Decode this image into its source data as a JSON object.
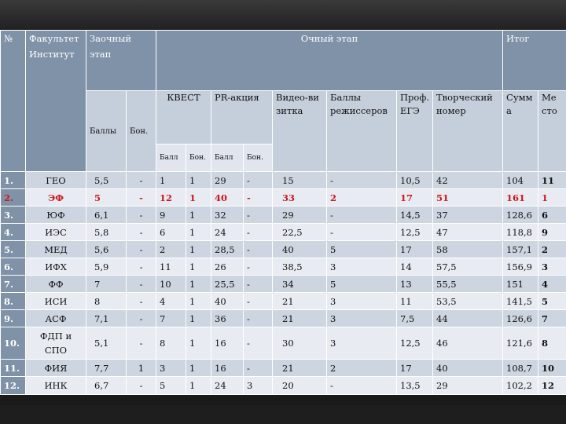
{
  "header": {
    "num": "№",
    "faculty": "Факультет Институт",
    "zaochny": "Заочный этап",
    "ochny": "Очный этап",
    "itog": "Итог",
    "balls": "Баллы",
    "bon": "Бон.",
    "kvest": "КВЕСТ",
    "pr": "PR-акция",
    "video": "Видео-ви зитка",
    "director": "Баллы режиссеров",
    "prof": "Проф. ЕГЭ",
    "tvorch": "Творческий номер",
    "summa": "Сумм а",
    "mesto": "Ме сто",
    "ball_sub": "Балл",
    "bon_sub": "Бон."
  },
  "rows": [
    {
      "n": "1.",
      "f": "ГЕО",
      "zb": "5,5",
      "zbon": "-",
      "kb": "1",
      "kbon": "1",
      "pb": "29",
      "pbon": "-",
      "v": "15",
      "d": "-",
      "p": "10,5",
      "t": "42",
      "s": "104",
      "m": "11",
      "highlight": false
    },
    {
      "n": "2.",
      "f": "ЭФ",
      "zb": "5",
      "zbon": "-",
      "kb": "12",
      "kbon": "1",
      "pb": "40",
      "pbon": "-",
      "v": "33",
      "d": "2",
      "p": "17",
      "t": "51",
      "s": "161",
      "m": "1",
      "highlight": true
    },
    {
      "n": "3.",
      "f": "ЮФ",
      "zb": "6,1",
      "zbon": "-",
      "kb": "9",
      "kbon": "1",
      "pb": "32",
      "pbon": "-",
      "v": "29",
      "d": "-",
      "p": "14,5",
      "t": "37",
      "s": "128,6",
      "m": "6",
      "highlight": false
    },
    {
      "n": "4.",
      "f": "ИЭС",
      "zb": "5,8",
      "zbon": "-",
      "kb": "6",
      "kbon": "1",
      "pb": "24",
      "pbon": "-",
      "v": "22,5",
      "d": "-",
      "p": "12,5",
      "t": "47",
      "s": "118,8",
      "m": "9",
      "highlight": false
    },
    {
      "n": "5.",
      "f": "МЕД",
      "zb": "5,6",
      "zbon": "-",
      "kb": "2",
      "kbon": "1",
      "pb": "28,5",
      "pbon": "-",
      "v": "40",
      "d": "5",
      "p": "17",
      "t": "58",
      "s": "157,1",
      "m": "2",
      "highlight": false
    },
    {
      "n": "6.",
      "f": "ИФХ",
      "zb": "5,9",
      "zbon": "-",
      "kb": "11",
      "kbon": "1",
      "pb": "26",
      "pbon": "-",
      "v": "38,5",
      "d": "3",
      "p": "14",
      "t": "57,5",
      "s": "156,9",
      "m": "3",
      "highlight": false
    },
    {
      "n": "7.",
      "f": "ФФ",
      "zb": "7",
      "zbon": "-",
      "kb": "10",
      "kbon": "1",
      "pb": "25,5",
      "pbon": "-",
      "v": "34",
      "d": "5",
      "p": "13",
      "t": "55,5",
      "s": "151",
      "m": "4",
      "highlight": false
    },
    {
      "n": "8.",
      "f": "ИСИ",
      "zb": "8",
      "zbon": "-",
      "kb": "4",
      "kbon": "1",
      "pb": "40",
      "pbon": "-",
      "v": "21",
      "d": "3",
      "p": "11",
      "t": "53,5",
      "s": "141,5",
      "m": "5",
      "highlight": false
    },
    {
      "n": "9.",
      "f": "АСФ",
      "zb": "7,1",
      "zbon": "-",
      "kb": "7",
      "kbon": "1",
      "pb": "36",
      "pbon": "-",
      "v": "21",
      "d": "3",
      "p": "7,5",
      "t": "44",
      "s": "126,6",
      "m": "7",
      "highlight": false
    },
    {
      "n": "10.",
      "f": "ФДП и СПО",
      "zb": "5,1",
      "zbon": "-",
      "kb": "8",
      "kbon": "1",
      "pb": "16",
      "pbon": "-",
      "v": "30",
      "d": "3",
      "p": "12,5",
      "t": "46",
      "s": "121,6",
      "m": "8",
      "highlight": false
    },
    {
      "n": "11.",
      "f": "ФИЯ",
      "zb": "7,7",
      "zbon": "1",
      "kb": "3",
      "kbon": "1",
      "pb": "16",
      "pbon": "-",
      "v": "21",
      "d": "2",
      "p": "17",
      "t": "40",
      "s": "108,7",
      "m": "10",
      "highlight": false
    },
    {
      "n": "12.",
      "f": "ИНК",
      "zb": "6,7",
      "zbon": "-",
      "kb": "5",
      "kbon": "1",
      "pb": "24",
      "pbon": "3",
      "v": "20",
      "d": "-",
      "p": "13,5",
      "t": "29",
      "s": "102,2",
      "m": "12",
      "highlight": false
    }
  ],
  "colors": {
    "header": "#8092a8",
    "row_dark": "#cdd5e0",
    "row_light": "#e8ecf2",
    "highlight": "#d0141c"
  }
}
